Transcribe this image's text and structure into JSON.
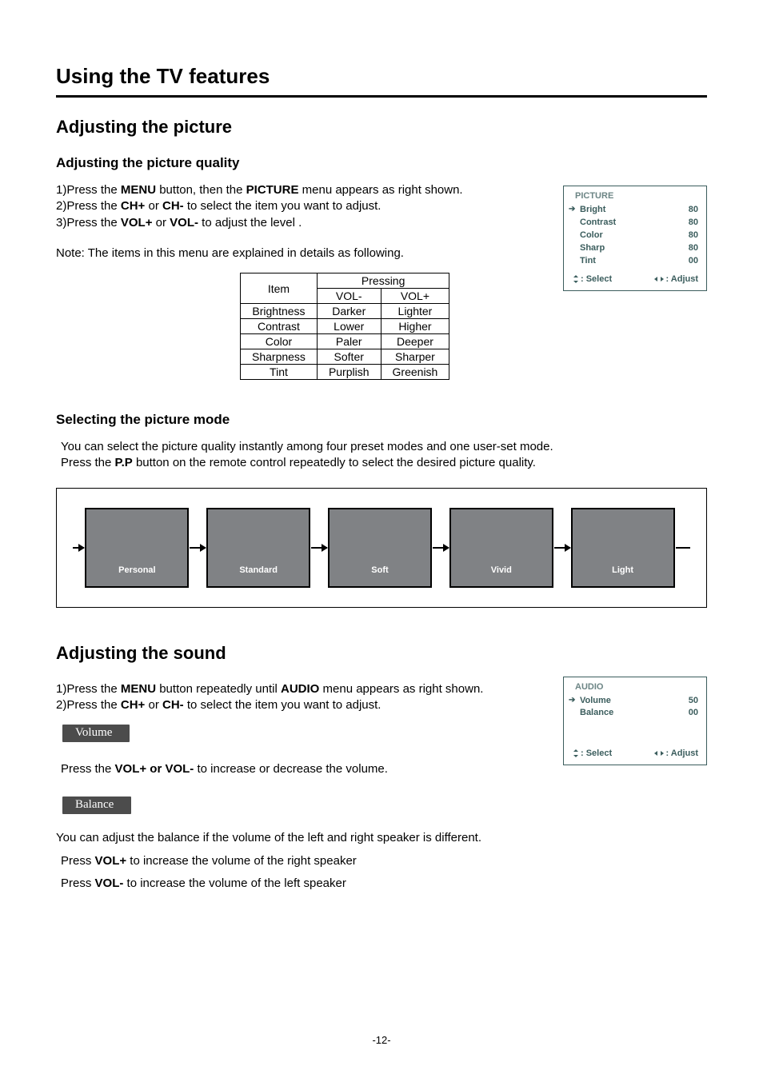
{
  "page_title": "Using the TV features",
  "sec1": {
    "title": "Adjusting the picture",
    "sub1": {
      "title": "Adjusting the picture quality",
      "line1a": "1)Press the ",
      "line1b": "MENU",
      "line1c": " button, then the ",
      "line1d": "PICTURE",
      "line1e": " menu appears as right shown.",
      "line2a": "2)Press the ",
      "line2b": "CH+",
      "line2c": " or ",
      "line2d": "CH-",
      "line2e": "  to select the item you want to adjust.",
      "line3a": "3)Press  the ",
      "line3b": "VOL+",
      "line3c": " or ",
      "line3d": "VOL-",
      "line3e": " to adjust the level .",
      "note": "Note: The items in this menu are explained in details as following."
    },
    "osd1": {
      "title": "PICTURE",
      "rows": [
        {
          "k": "Bright",
          "v": "80",
          "sel": true
        },
        {
          "k": "Contrast",
          "v": "80"
        },
        {
          "k": "Color",
          "v": "80"
        },
        {
          "k": "Sharp",
          "v": "80"
        },
        {
          "k": "Tint",
          "v": "00"
        }
      ],
      "foot_select": ": Select",
      "foot_adjust": ": Adjust"
    },
    "table": {
      "hdr_item": "Item",
      "hdr_pressing": "Pressing",
      "hdr_volminus": "VOL-",
      "hdr_volplus": "VOL+",
      "rows": [
        {
          "item": "Brightness",
          "minus": "Darker",
          "plus": "Lighter"
        },
        {
          "item": "Contrast",
          "minus": "Lower",
          "plus": "Higher"
        },
        {
          "item": "Color",
          "minus": "Paler",
          "plus": "Deeper"
        },
        {
          "item": "Sharpness",
          "minus": "Softer",
          "plus": "Sharper"
        },
        {
          "item": "Tint",
          "minus": "Purplish",
          "plus": "Greenish"
        }
      ]
    },
    "sub2": {
      "title": "Selecting the picture mode",
      "line1": "You can select the picture quality instantly among four preset modes and one user-set mode.",
      "line2a": "Press the ",
      "line2b": "P.P",
      "line2c": " button on the remote control repeatedly to select the desired picture quality.",
      "modes": [
        "Personal",
        "Standard",
        "Soft",
        "Vivid",
        "Light"
      ]
    }
  },
  "sec2": {
    "title": "Adjusting the sound",
    "line1a": "1)Press the ",
    "line1b": "MENU",
    "line1c": " button repeatedly until ",
    "line1d": "AUDIO",
    "line1e": " menu appears as  right shown.",
    "line2a": "2)Press the ",
    "line2b": "CH+",
    "line2c": " or ",
    "line2d": "CH-",
    "line2e": " to select the item you want to  adjust.",
    "osd2": {
      "title": "AUDIO",
      "rows": [
        {
          "k": "Volume",
          "v": "50",
          "sel": true
        },
        {
          "k": "Balance",
          "v": "00"
        }
      ],
      "foot_select": ": Select",
      "foot_adjust": ": Adjust"
    },
    "vol_label": "Volume",
    "vol_text_a": "Press the ",
    "vol_text_b": "VOL+ or VOL-",
    "vol_text_c": " to increase or decrease the volume.",
    "bal_label": "Balance",
    "bal_text1": "You can adjust the balance if the volume of the left and right speaker is different.",
    "bal_text2a": "Press ",
    "bal_text2b": "VOL+",
    "bal_text2c": " to  increase the volume of the right speaker",
    "bal_text3a": "Press ",
    "bal_text3b": "VOL-",
    "bal_text3c": " to  increase the volume of the left speaker"
  },
  "page_number": "-12-"
}
